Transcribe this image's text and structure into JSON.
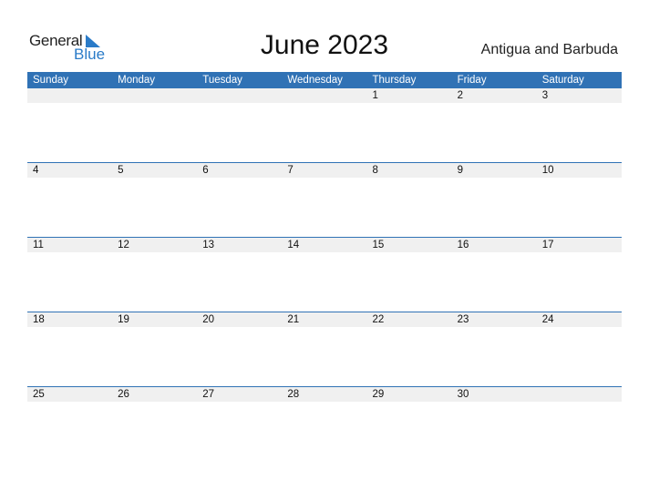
{
  "logo": {
    "line1": "General",
    "line2": "Blue",
    "icon": "triangle-flag-icon",
    "color": "#2A7BC8"
  },
  "title": "June 2023",
  "country": "Antigua and Barbuda",
  "colors": {
    "header_bg": "#3072B5",
    "day_row_bg": "#F0F0F0"
  },
  "weekdays": [
    "Sunday",
    "Monday",
    "Tuesday",
    "Wednesday",
    "Thursday",
    "Friday",
    "Saturday"
  ],
  "weeks": [
    [
      "",
      "",
      "",
      "",
      "1",
      "2",
      "3"
    ],
    [
      "4",
      "5",
      "6",
      "7",
      "8",
      "9",
      "10"
    ],
    [
      "11",
      "12",
      "13",
      "14",
      "15",
      "16",
      "17"
    ],
    [
      "18",
      "19",
      "20",
      "21",
      "22",
      "23",
      "24"
    ],
    [
      "25",
      "26",
      "27",
      "28",
      "29",
      "30",
      ""
    ]
  ]
}
